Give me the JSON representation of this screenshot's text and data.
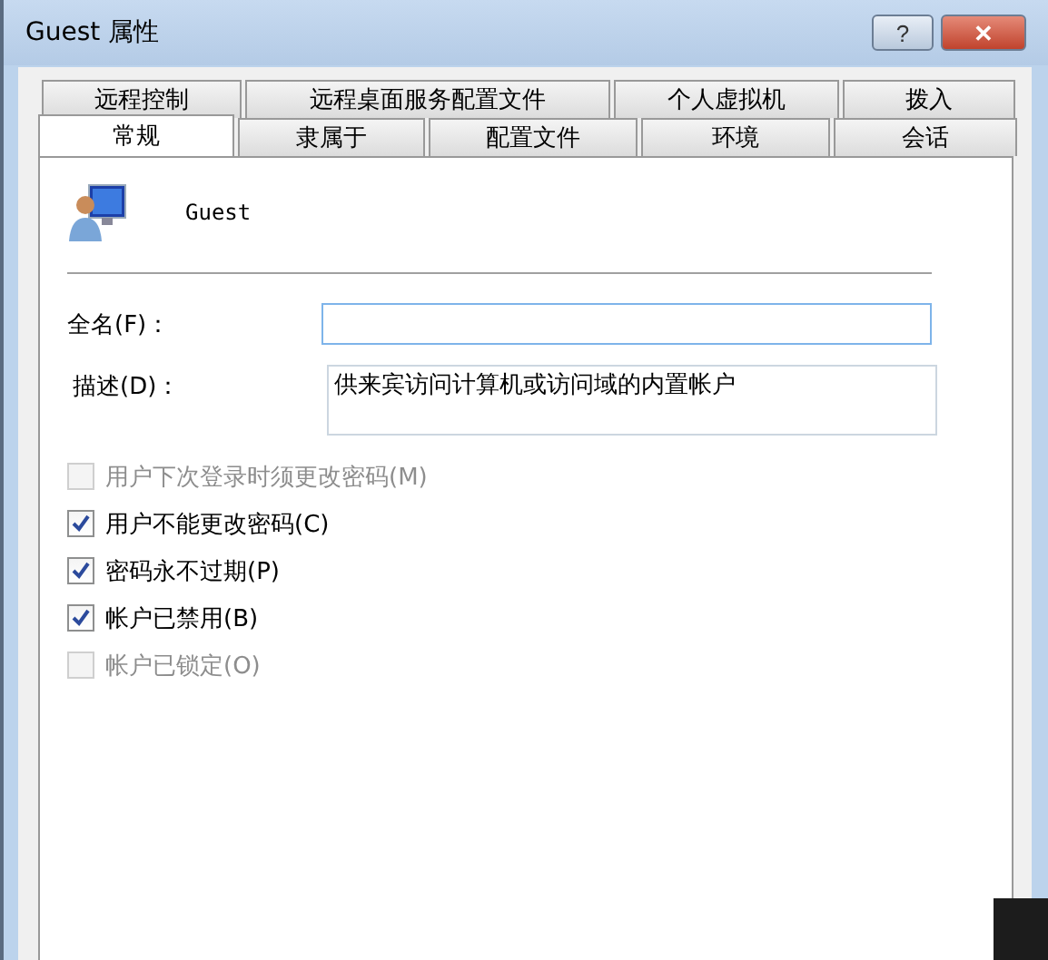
{
  "window": {
    "title": "Guest 属性",
    "buttons": [
      {
        "kind": "help",
        "label": "?"
      },
      {
        "kind": "close",
        "label": "✕"
      }
    ]
  },
  "tab_rows": [
    [
      {
        "label": "远程控制",
        "selected": false
      },
      {
        "label": "远程桌面服务配置文件",
        "selected": false
      },
      {
        "label": "个人虚拟机",
        "selected": false
      },
      {
        "label": "拨入",
        "selected": false
      }
    ],
    [
      {
        "label": "常规",
        "selected": true
      },
      {
        "label": "隶属于",
        "selected": false
      },
      {
        "label": "配置文件",
        "selected": false
      },
      {
        "label": "环境",
        "selected": false
      },
      {
        "label": "会话",
        "selected": false
      }
    ]
  ],
  "user": {
    "name": "Guest"
  },
  "fields": [
    {
      "kind": "line",
      "label": "全名(F)："
    },
    {
      "kind": "area",
      "label": "描述(D)：",
      "value": "供来宾访问计算机或访问域的内置帐户"
    }
  ],
  "options": [
    {
      "label": "用户下次登录时须更改密码(M)",
      "checked": false,
      "disabled": true
    },
    {
      "label": "用户不能更改密码(C)",
      "checked": true,
      "disabled": false
    },
    {
      "label": "密码永不过期(P)",
      "checked": true,
      "disabled": false
    },
    {
      "label": "帐户已禁用(B)",
      "checked": true,
      "disabled": false
    },
    {
      "label": "帐户已锁定(O)",
      "checked": false,
      "disabled": true
    }
  ]
}
